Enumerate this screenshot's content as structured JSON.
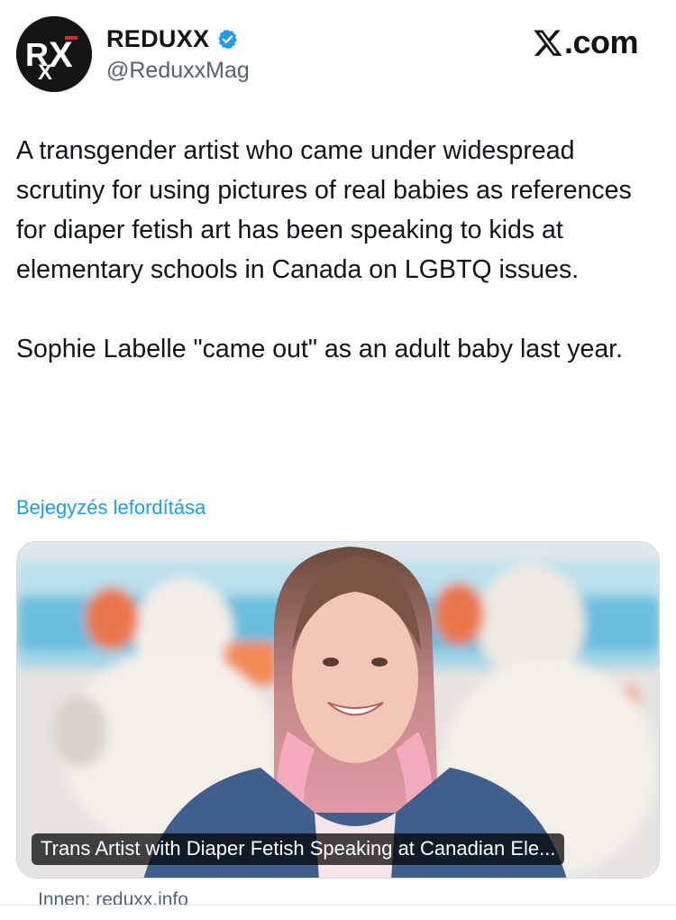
{
  "header": {
    "avatar_text": "RXX",
    "display_name": "REDUXX",
    "verified_icon": "verified-badge-icon",
    "handle": "@ReduxxMag",
    "brand_icon": "x-logo-icon",
    "brand_text": ".com"
  },
  "tweet": {
    "text": "A transgender artist who came under widespread scrutiny for using pictures of real babies as references for diaper fetish art has been speaking to kids at elementary schools in Canada on LGBTQ issues.\n\nSophie Labelle \"came out\" as an adult baby last year.",
    "translate_label": "Bejegyzés lefordítása"
  },
  "card": {
    "title": "Trans Artist with Diaper Fetish Speaking at Canadian Ele...",
    "source_label": "Innen: reduxx.info"
  },
  "colors": {
    "link": "#1d9bf0",
    "verified": "#1d9bf0",
    "secondary_text": "#536471"
  }
}
